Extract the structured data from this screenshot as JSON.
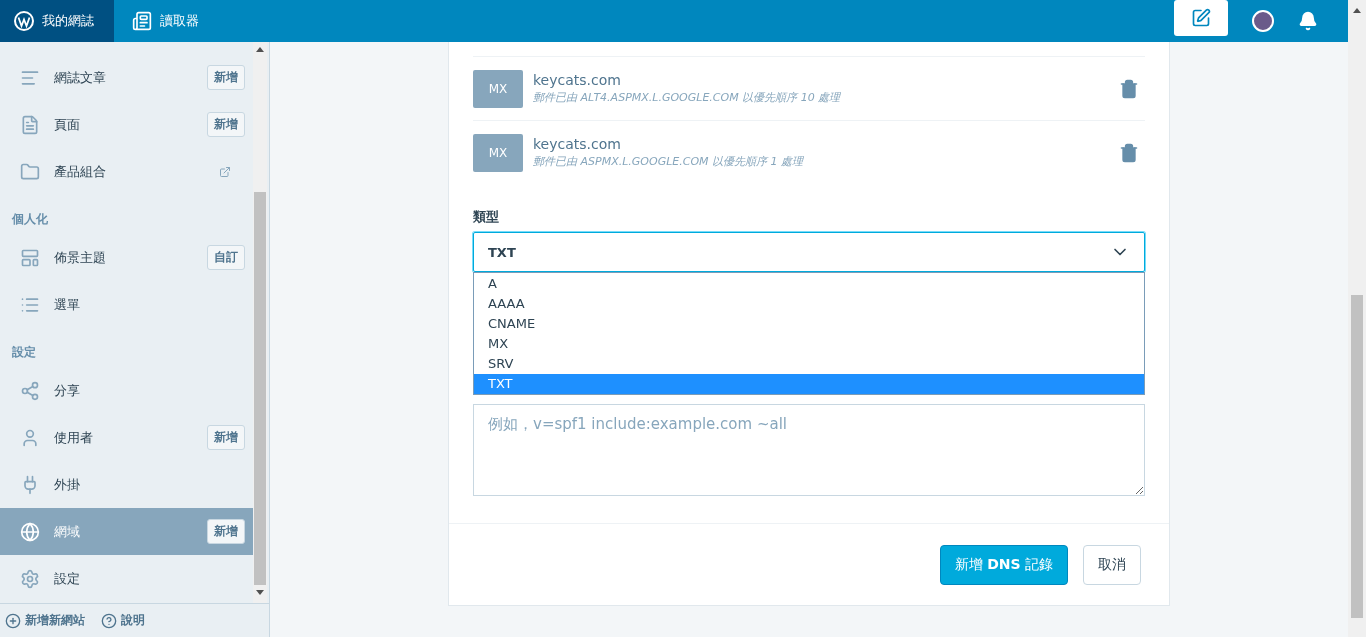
{
  "topbar": {
    "my_site": "我的網誌",
    "reader": "讀取器"
  },
  "sidebar": {
    "sections": [
      {
        "items": [
          {
            "label": "網誌文章",
            "badge": "新增",
            "external": false,
            "selected": false
          },
          {
            "label": "頁面",
            "badge": "新增",
            "external": false,
            "selected": false
          },
          {
            "label": "產品組合",
            "external": true,
            "selected": false
          }
        ]
      },
      {
        "heading": "個人化",
        "items": [
          {
            "label": "佈景主題",
            "badge": "自訂",
            "external": false,
            "selected": false
          },
          {
            "label": "選單",
            "external": false,
            "selected": false
          }
        ]
      },
      {
        "heading": "設定",
        "items": [
          {
            "label": "分享",
            "external": false,
            "selected": false
          },
          {
            "label": "使用者",
            "badge": "新增",
            "external": false,
            "selected": false
          },
          {
            "label": "外掛",
            "external": false,
            "selected": false
          },
          {
            "label": "網域",
            "badge": "新增",
            "external": false,
            "selected": true
          },
          {
            "label": "設定",
            "external": false,
            "selected": false
          }
        ]
      }
    ],
    "footer": [
      "新增新網站",
      "說明"
    ]
  },
  "records": [
    {
      "type": "MX",
      "name": "keycats.com",
      "detail": "郵件已由 ALT4.ASPMX.L.GOOGLE.COM 以優先順序 10 處理"
    },
    {
      "type": "MX",
      "name": "keycats.com",
      "detail": "郵件已由 ASPMX.L.GOOGLE.COM 以優先順序 1 處理"
    }
  ],
  "form": {
    "type_label": "類型",
    "select_value": "TXT",
    "expanded": true,
    "options": [
      {
        "label": "A",
        "selected": false
      },
      {
        "label": "AAAA",
        "selected": false
      },
      {
        "label": "CNAME",
        "selected": false
      },
      {
        "label": "MX",
        "selected": false
      },
      {
        "label": "SRV",
        "selected": false
      },
      {
        "label": "TXT",
        "selected": true
      }
    ],
    "textarea": {
      "placeholder": "例如，v=spf1 include:example.com ~all"
    },
    "buttons": [
      {
        "label": "新增 **DNS** 記錄",
        "kind": "primary"
      },
      {
        "label": "取消",
        "kind": "secondary"
      }
    ]
  }
}
